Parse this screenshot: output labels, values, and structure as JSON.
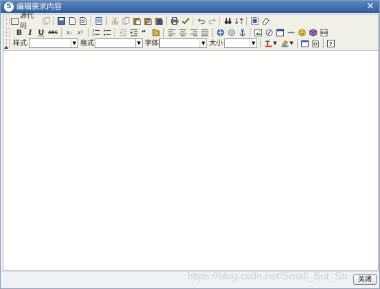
{
  "window": {
    "title": "编辑需求内容",
    "close_glyph": "✕"
  },
  "toolbar": {
    "source_label": "源代码",
    "bold": "B",
    "italic": "I",
    "underline": "U",
    "strike": "ABC",
    "subscript": "x₁",
    "superscript": "x²",
    "style_label": "样式",
    "format_label": "格式",
    "font_label": "字体",
    "size_label": "大小",
    "style_value": "",
    "format_value": "",
    "font_value": "",
    "size_value": ""
  },
  "footer": {
    "close_button": "关闭",
    "watermark": "https://blog.csdn.net/Small_But_Str"
  }
}
